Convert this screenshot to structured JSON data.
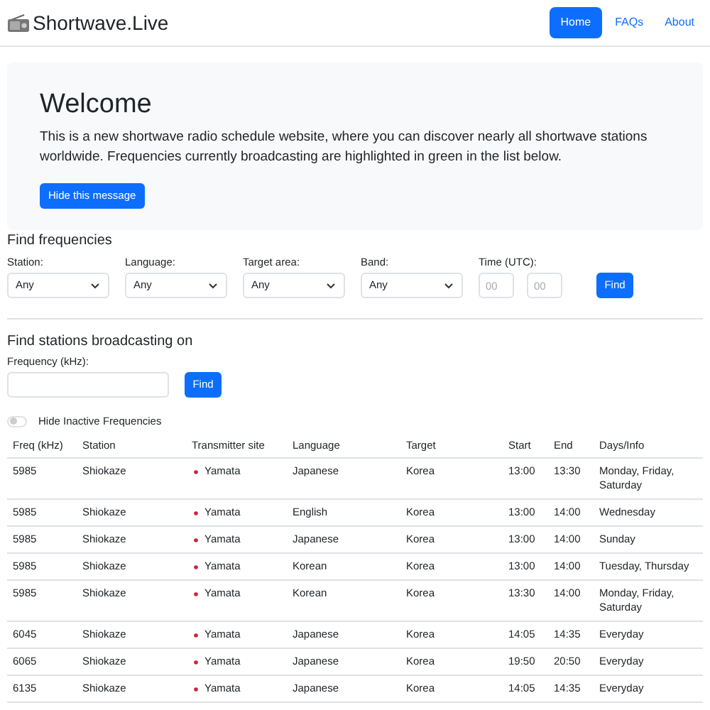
{
  "brand": "Shortwave.Live",
  "nav": [
    {
      "label": "Home",
      "selected": true
    },
    {
      "label": "FAQs",
      "selected": false
    },
    {
      "label": "About",
      "selected": false
    }
  ],
  "welcome": {
    "title": "Welcome",
    "text": "This is a new shortwave radio schedule website, where you can discover nearly all shortwave stations worldwide. Frequencies currently broadcasting are highlighted in green in the list below.",
    "button": "Hide this message"
  },
  "find_frequencies": {
    "title": "Find frequencies",
    "selects": [
      {
        "label": "Station:",
        "value": "Any"
      },
      {
        "label": "Language:",
        "value": "Any"
      },
      {
        "label": "Target area:",
        "value": "Any"
      },
      {
        "label": "Band:",
        "value": "Any"
      }
    ],
    "time": {
      "label": "Time (UTC):",
      "hour_placeholder": "00",
      "minute_placeholder": "00"
    },
    "button": "Find"
  },
  "find_stations": {
    "title": "Find stations broadcasting on",
    "label": "Frequency (kHz):",
    "button": "Find"
  },
  "hide_inactive": {
    "label": "Hide Inactive Frequencies",
    "on": false
  },
  "table": {
    "columns": [
      "Freq (kHz)",
      "Station",
      "Transmitter site",
      "Language",
      "Target",
      "Start",
      "End",
      "Days/Info"
    ],
    "rows": [
      [
        "5985",
        "Shiokaze",
        "Yamata",
        "Japanese",
        "Korea",
        "13:00",
        "13:30",
        "Monday, Friday, Saturday"
      ],
      [
        "5985",
        "Shiokaze",
        "Yamata",
        "English",
        "Korea",
        "13:00",
        "14:00",
        "Wednesday"
      ],
      [
        "5985",
        "Shiokaze",
        "Yamata",
        "Japanese",
        "Korea",
        "13:00",
        "14:00",
        "Sunday"
      ],
      [
        "5985",
        "Shiokaze",
        "Yamata",
        "Korean",
        "Korea",
        "13:00",
        "14:00",
        "Tuesday, Thursday"
      ],
      [
        "5985",
        "Shiokaze",
        "Yamata",
        "Korean",
        "Korea",
        "13:30",
        "14:00",
        "Monday, Friday, Saturday"
      ],
      [
        "6045",
        "Shiokaze",
        "Yamata",
        "Japanese",
        "Korea",
        "14:05",
        "14:35",
        "Everyday"
      ],
      [
        "6065",
        "Shiokaze",
        "Yamata",
        "Japanese",
        "Korea",
        "19:50",
        "20:50",
        "Everyday"
      ],
      [
        "6135",
        "Shiokaze",
        "Yamata",
        "Japanese",
        "Korea",
        "14:05",
        "14:35",
        "Everyday"
      ]
    ]
  }
}
